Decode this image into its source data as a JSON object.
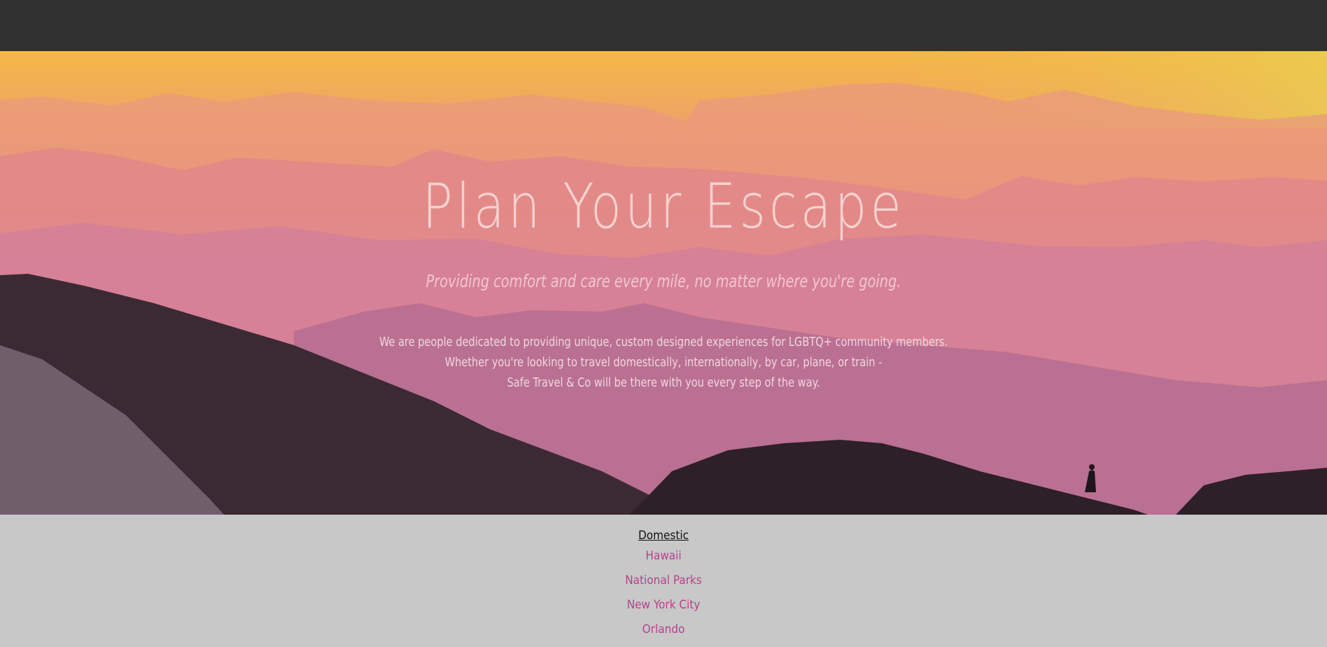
{
  "hero": {
    "title": "Plan Your Escape",
    "subtitle": "Providing comfort and care every mile, no matter where you're going.",
    "body_lines": [
      "We are people dedicated to providing unique, custom designed experiences for LGBTQ+ community members.",
      "Whether you're looking to travel domestically, internationally, by car, plane, or train -",
      "Safe Travel & Co will be there with you every step of the way."
    ]
  },
  "menu": {
    "heading": "Domestic",
    "items": [
      "Hawaii",
      "National Parks",
      "New York City",
      "Orlando"
    ]
  },
  "colors": {
    "topbar": "#303030",
    "menu_background": "#c8c8c8",
    "link": "#b8408c",
    "title": "#f6d2d0"
  }
}
